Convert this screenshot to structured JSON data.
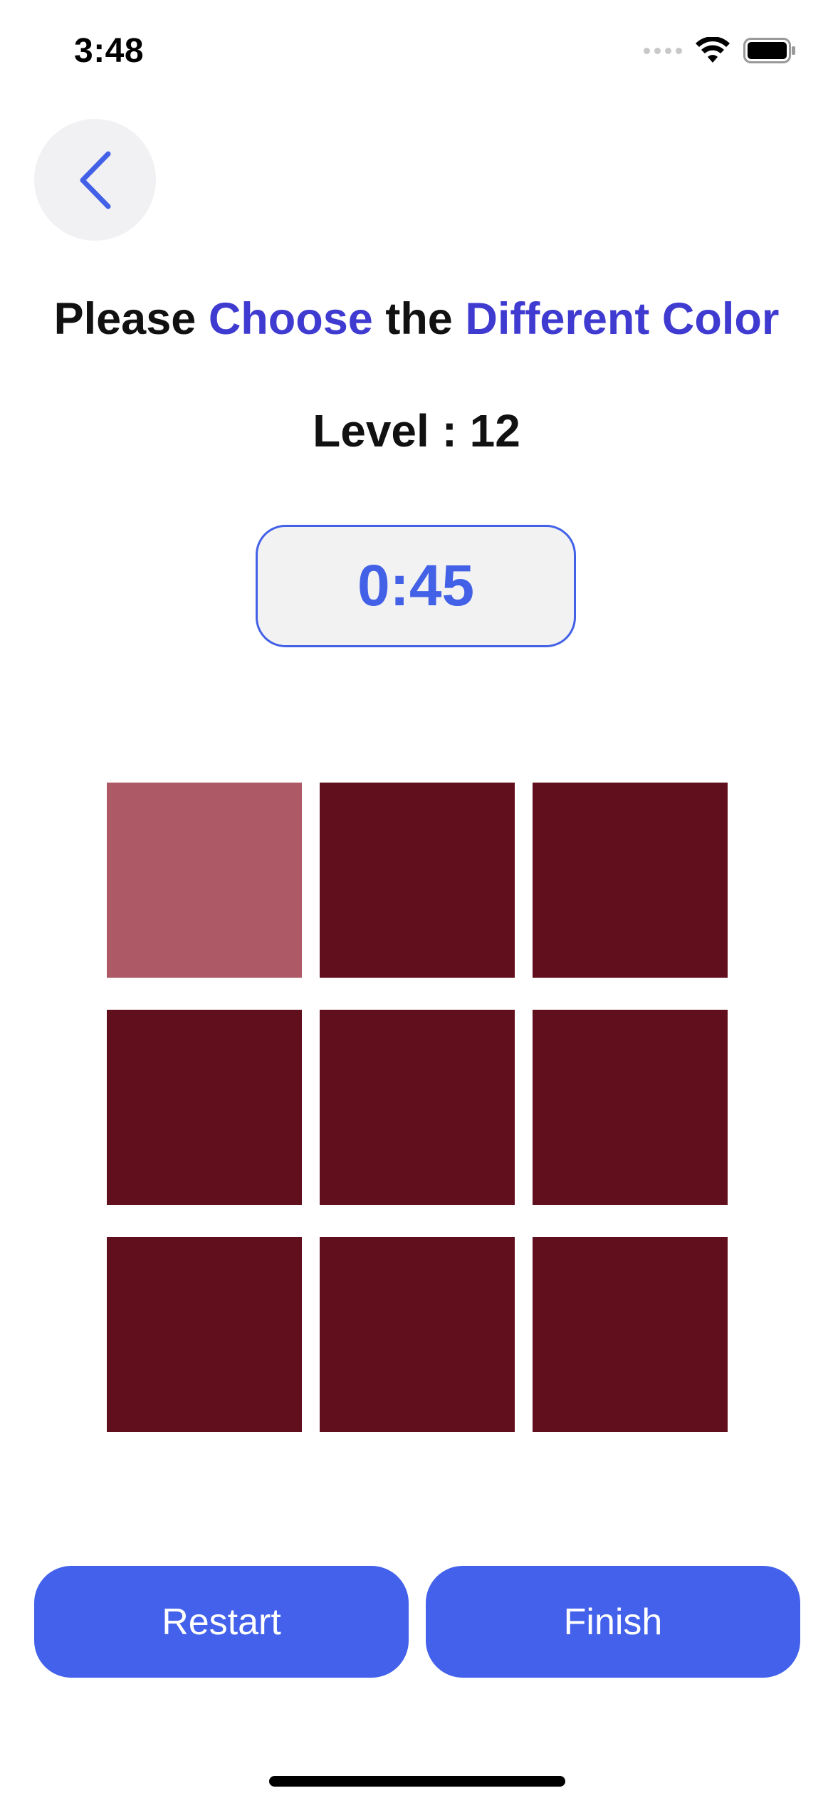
{
  "status_bar": {
    "time": "3:48"
  },
  "back": {
    "icon": "chevron-left-icon"
  },
  "heading": {
    "part1": "Please ",
    "part2": "Choose",
    "part3": " the ",
    "part4": "Different Color"
  },
  "level": {
    "text": "Level : 12"
  },
  "timer": {
    "value": "0:45"
  },
  "grid": {
    "base_color": "#620f1d",
    "odd_color": "#ad5a66",
    "odd_index": 0,
    "tiles": 9
  },
  "buttons": {
    "restart": "Restart",
    "finish": "Finish"
  },
  "colors": {
    "accent": "#3f3ad0",
    "primary": "#4361ea"
  }
}
